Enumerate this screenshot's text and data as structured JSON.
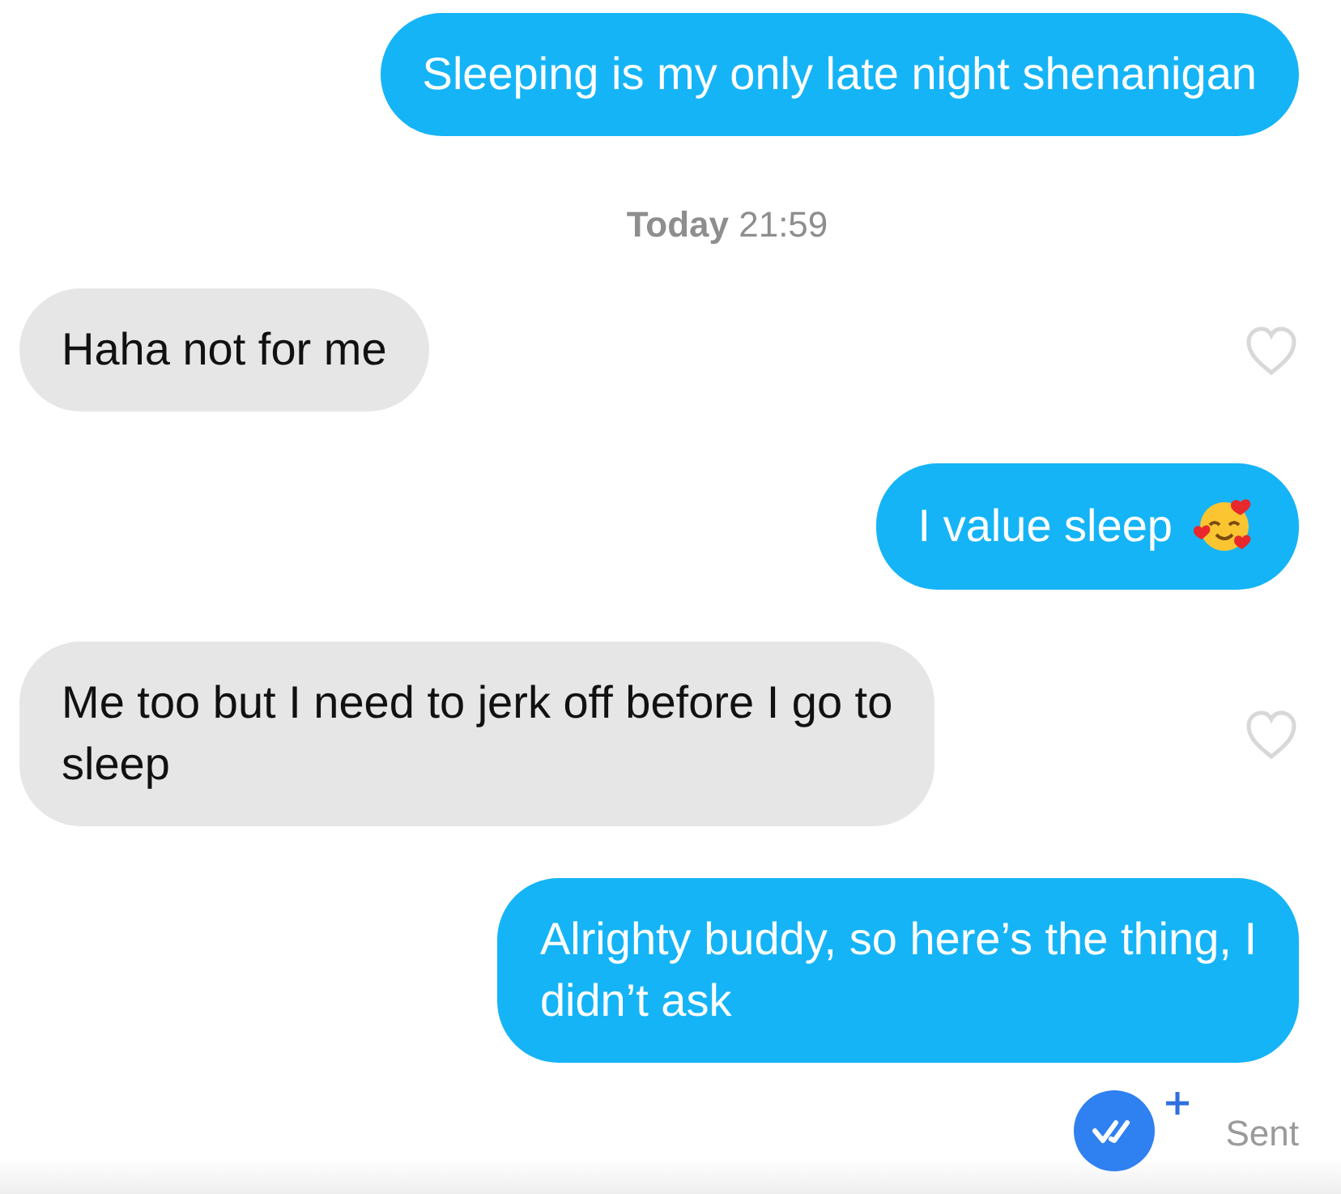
{
  "messages": [
    {
      "kind": "out",
      "text": "Sleeping is my only late night shenanigan"
    },
    {
      "kind": "time",
      "text": "**Today** 21:59"
    },
    {
      "kind": "in",
      "text": "Haha not for me",
      "liked": false
    },
    {
      "kind": "out",
      "text": "I value sleep",
      "emoji": true
    },
    {
      "kind": "in",
      "text": "Me too but I need to jerk off before I go to\nsleep",
      "liked": false
    },
    {
      "kind": "out",
      "text": "Alrighty buddy, so here’s the thing, I\ndidn’t ask"
    }
  ],
  "status": {
    "text": "Sent"
  }
}
